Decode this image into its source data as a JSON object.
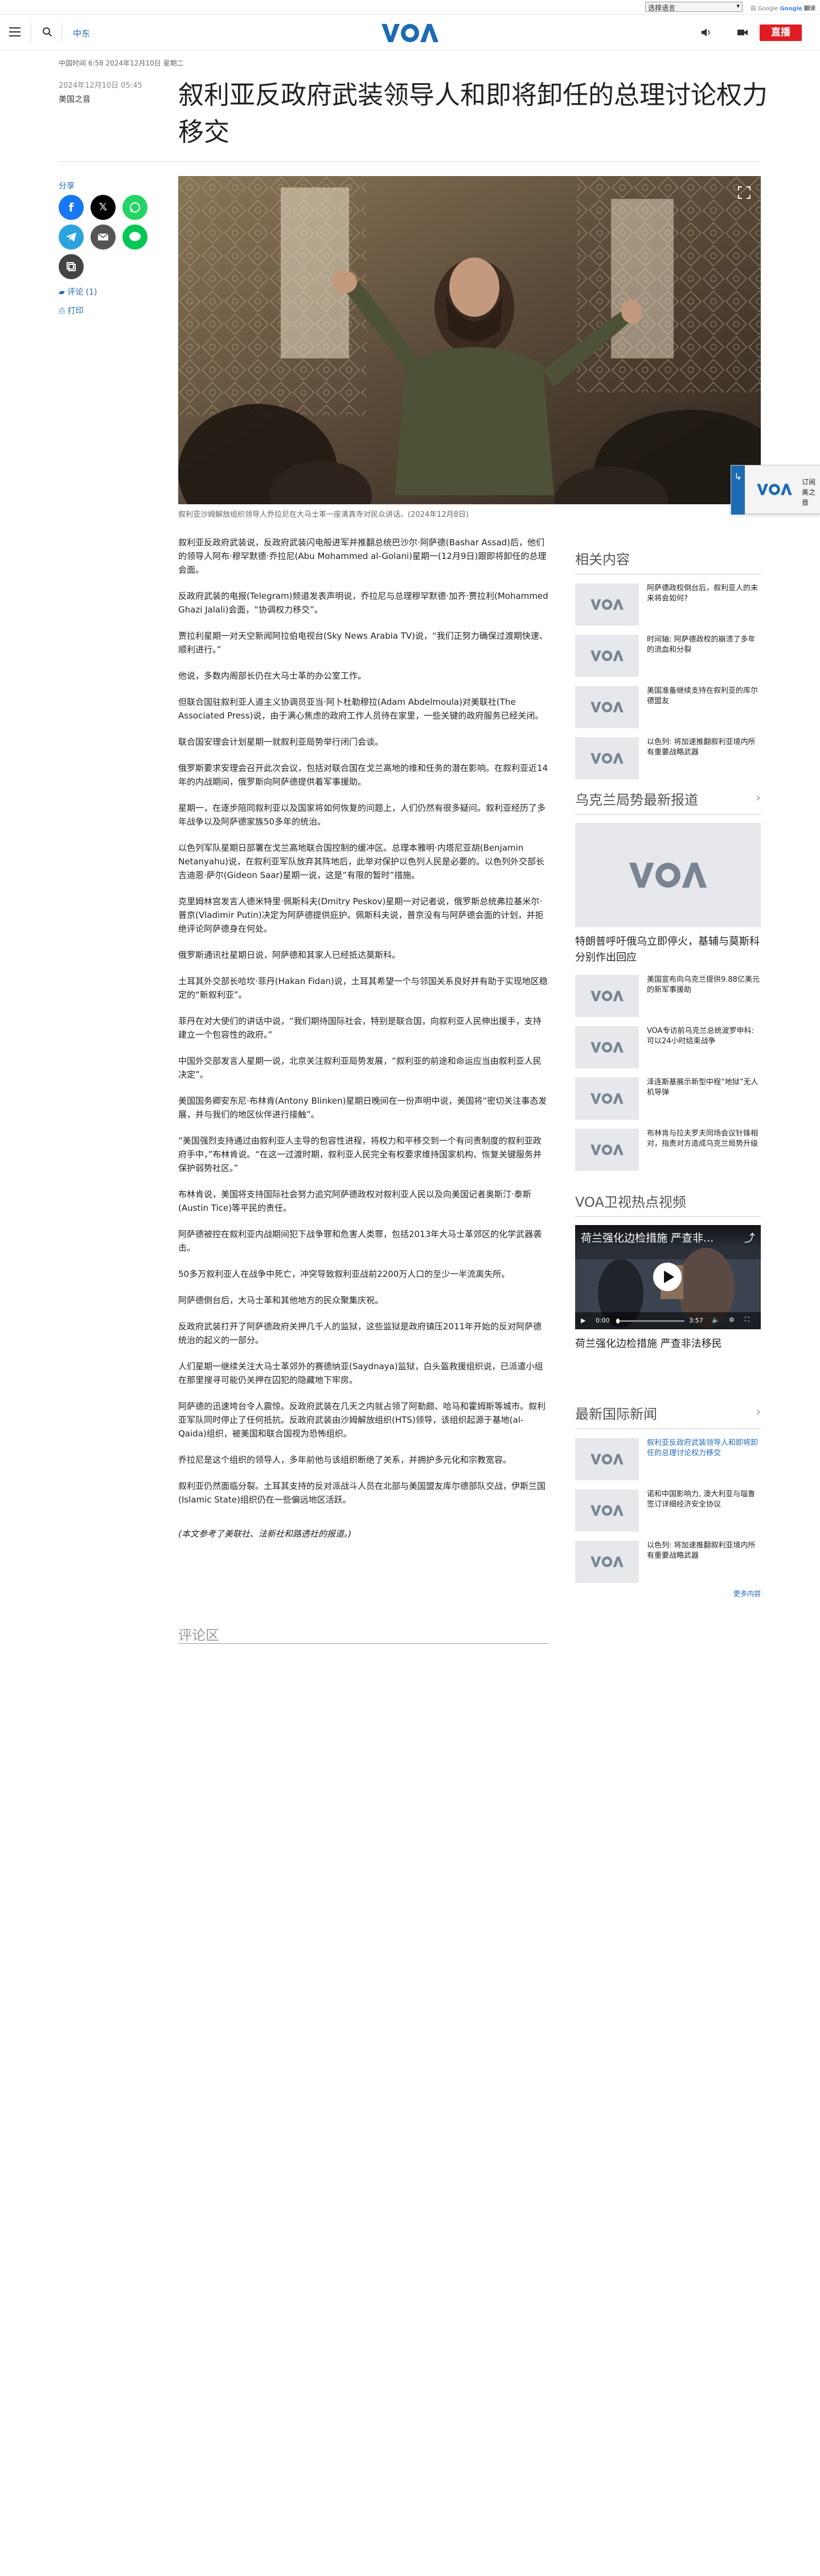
{
  "translate": {
    "select_label": "选择语言",
    "powered_by": "由 Google",
    "google": "Google",
    "translate_word": "翻译"
  },
  "header": {
    "section": "中东",
    "logo_text": "VOA",
    "live_label": "直播"
  },
  "meta": {
    "top_line": "中国时间 6:58 2024年12月10日 星期二",
    "pub_date": "2024年12月10日 05:45",
    "source": "美国之音"
  },
  "article": {
    "title": "叙利亚反政府武装领导人和即将卸任的总理讨论权力移交",
    "share_label": "分享",
    "comments_link": "评论 (1)",
    "print_link": "打印",
    "caption": "叙利亚沙姆解放组织领导人乔拉尼在大马士革一座清真寺对民众讲话。(2024年12月8日)",
    "paragraphs": [
      "叙利亚反政府武装说，反政府武装闪电般进军并推翻总统巴沙尔·阿萨德(Bashar Assad)后，他们的领导人阿布·穆罕默德·乔拉尼(Abu Mohammed al-Golani)星期一(12月9日)跟即将卸任的总理会面。",
      "反政府武装的电报(Telegram)频道发表声明说，乔拉尼与总理穆罕默德·加齐·贾拉利(Mohammed Ghazi Jalali)会面，“协调权力移交”。",
      "贾拉利星期一对天空新闻阿拉伯电视台(Sky News Arabia TV)说，“我们正努力确保过渡期快速、顺利进行。”",
      "他说，多数内阁部长仍在大马士革的办公室工作。",
      "但联合国驻叙利亚人道主义协调员亚当·阿卜杜勒穆拉(Adam Abdelmoula)对美联社(The Associated Press)说，由于满心焦虑的政府工作人员待在家里，一些关键的政府服务已经关闭。",
      "联合国安理会计划星期一就叙利亚局势举行闭门会谈。",
      "俄罗斯要求安理会召开此次会议，包括对联合国在戈兰高地的维和任务的潜在影响。在叙利亚近14年的内战期间，俄罗斯向阿萨德提供着军事援助。",
      "星期一，在逐步陪同叙利亚以及国家将如何恢复的问题上，人们仍然有很多疑问。叙利亚经历了多年战争以及阿萨德家族50多年的统治。",
      "以色列军队星期日部署在戈兰高地联合国控制的缓冲区。总理本雅明·内塔尼亚胡(Benjamin Netanyahu)说，在叙利亚军队放弃其阵地后，此举对保护以色列人民是必要的。以色列外交部长吉迪恩·萨尔(Gideon Saar)星期一说，这是“有限的暂时”措施。",
      "克里姆林宫发言人德米特里·佩斯科夫(Dmitry Peskov)星期一对记者说，俄罗斯总统弗拉基米尔·普京(Vladimir Putin)决定为阿萨德提供庇护。佩斯科夫说，普京没有与阿萨德会面的计划，并拒绝评论阿萨德身在何处。",
      "俄罗斯通讯社星期日说，阿萨德和其家人已经抵达莫斯科。",
      "土耳其外交部长哈坎·菲丹(Hakan Fidan)说，土耳其希望一个与邻国关系良好并有助于实现地区稳定的“新叙利亚”。",
      "菲丹在对大使们的讲话中说，“我们期待国际社会，特别是联合国，向叙利亚人民伸出援手，支持建立一个包容性的政府。”",
      "中国外交部发言人星期一说，北京关注叙利亚局势发展，“叙利亚的前途和命运应当由叙利亚人民决定”。",
      "美国国务卿安东尼·布林肯(Antony Blinken)星期日晚间在一份声明中说，美国将“密切关注事态发展，并与我们的地区伙伴进行接触”。",
      "“美国强烈支持通过由叙利亚人主导的包容性进程，将权力和平移交到一个有问责制度的叙利亚政府手中，”布林肯说。“在这一过渡时期，叙利亚人民完全有权要求维持国家机构、恢复关键服务并保护弱势社区。”",
      "布林肯说，美国将支持国际社会努力追究阿萨德政权对叙利亚人民以及向美国记者奥斯汀·泰斯(Austin Tice)等平民的责任。",
      "阿萨德被控在叙利亚内战期间犯下战争罪和危害人类罪，包括2013年大马士革郊区的化学武器袭击。",
      "50多万叙利亚人在战争中死亡，冲突导致叙利亚战前2200万人口的至少一半流离失所。",
      "阿萨德倒台后，大马士革和其他地方的民众聚集庆祝。",
      "反政府武装打开了阿萨德政府关押几千人的监狱，这些监狱是政府镇压2011年开始的反对阿萨德统治的起义的一部分。",
      "人们星期一继续关注大马士革郊外的赛德纳亚(Saydnaya)监狱，白头盔救援组织说，已派遣小组在那里搜寻可能仍关押在囚犯的隐藏地下牢房。",
      "阿萨德的迅速垮台令人震惊。反政府武装在几天之内就占领了阿勒颇、哈马和霍姆斯等城市。叙利亚军队同时停止了任何抵抗。反政府武装由沙姆解放组织(HTS)领导，该组织起源于基地(al-Qaida)组织，被美国和联合国视为恐怖组织。",
      "乔拉尼是这个组织的领导人，多年前他与该组织断绝了关系，并拥护多元化和宗教宽容。",
      "叙利亚仍然面临分裂。土耳其支持的反对派战斗人员在北部与美国盟友库尔德部队交战，伊斯兰国(Islamic State)组织仍在一些偏远地区活跃。"
    ],
    "note": "(本文参考了美联社、法新社和路透社的报道。)",
    "comments_heading": "评论区"
  },
  "sidebar": {
    "related": {
      "heading": "相关内容",
      "items": [
        "阿萨德政权倒台后，叙利亚人的未来将会如何?",
        "时间轴: 阿萨德政权的崩溃了多年的流血和分裂",
        "美国准备继续支持在叙利亚的库尔德盟友",
        "以色列: 将加速推翻叙利亚境内所有重要战略武器"
      ]
    },
    "ukraine": {
      "heading": "乌克兰局势最新报道",
      "feature_title": "特朗普呼吁俄乌立即停火，基辅与莫斯科分别作出回应",
      "items": [
        "美国宣布向乌克兰提供9.88亿美元的新军事援助",
        "VOA专访前乌克兰总统波罗申科: 可以24小时结束战争",
        "泽连斯基展示新型中程“地狱”无人机导弹",
        "布林肯与拉夫罗夫同场会议针锋相对，指责对方造成乌克兰局势升级"
      ]
    },
    "video": {
      "heading": "VOA卫视热点视频",
      "video_title": "荷兰强化边检措施 严查非...",
      "time": "0:00",
      "duration": "3:57",
      "caption": "荷兰强化边检措施 严查非法移民"
    },
    "world": {
      "heading": "最新国际新闻",
      "items": [
        "叙利亚反政府武装领导人和即将卸任的总理讨论权力移交",
        "诺和中国影响力, 澳大利亚与瑙鲁签订详细经济安全协议",
        "以色列: 将加速推翻叙利亚境内所有重要战略武器"
      ],
      "more": "更多内容"
    }
  },
  "float_widget": {
    "text": "订阅\n美之音"
  }
}
